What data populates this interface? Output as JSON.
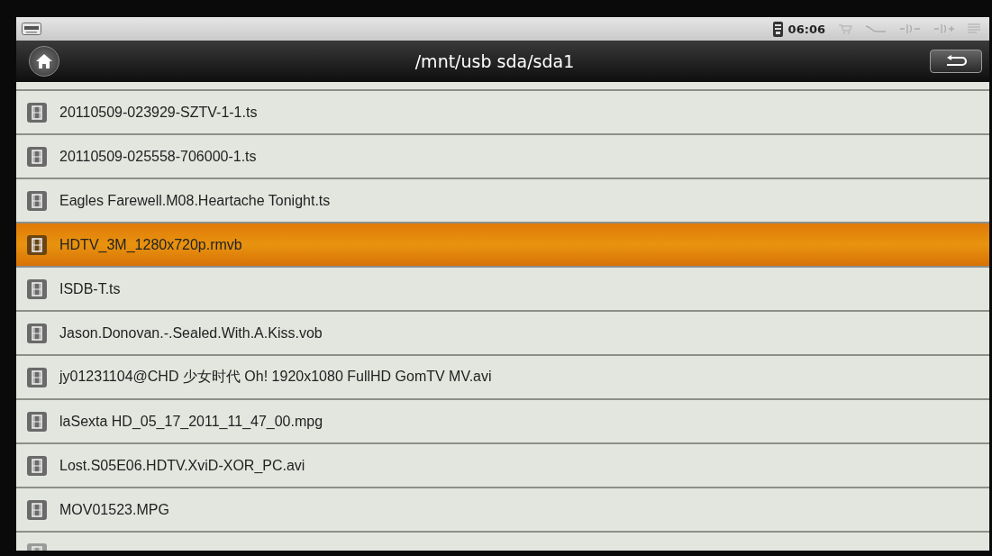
{
  "status_bar": {
    "time": "06:06"
  },
  "title_bar": {
    "title": "/mnt/usb sda/sda1"
  },
  "files": [
    {
      "name": "20110509-023929-SZTV-1-1.ts",
      "selected": false
    },
    {
      "name": "20110509-025558-706000-1.ts",
      "selected": false
    },
    {
      "name": "Eagles Farewell.M08.Heartache Tonight.ts",
      "selected": false
    },
    {
      "name": "HDTV_3M_1280x720p.rmvb",
      "selected": true
    },
    {
      "name": "ISDB-T.ts",
      "selected": false
    },
    {
      "name": "Jason.Donovan.-.Sealed.With.A.Kiss.vob",
      "selected": false
    },
    {
      "name": "jy01231104@CHD 少女时代 Oh! 1920x1080 FullHD GomTV MV.avi",
      "selected": false
    },
    {
      "name": "laSexta HD_05_17_2011_11_47_00.mpg",
      "selected": false
    },
    {
      "name": "Lost.S05E06.HDTV.XviD-XOR_PC.avi",
      "selected": false
    },
    {
      "name": "MOV01523.MPG",
      "selected": false
    }
  ]
}
